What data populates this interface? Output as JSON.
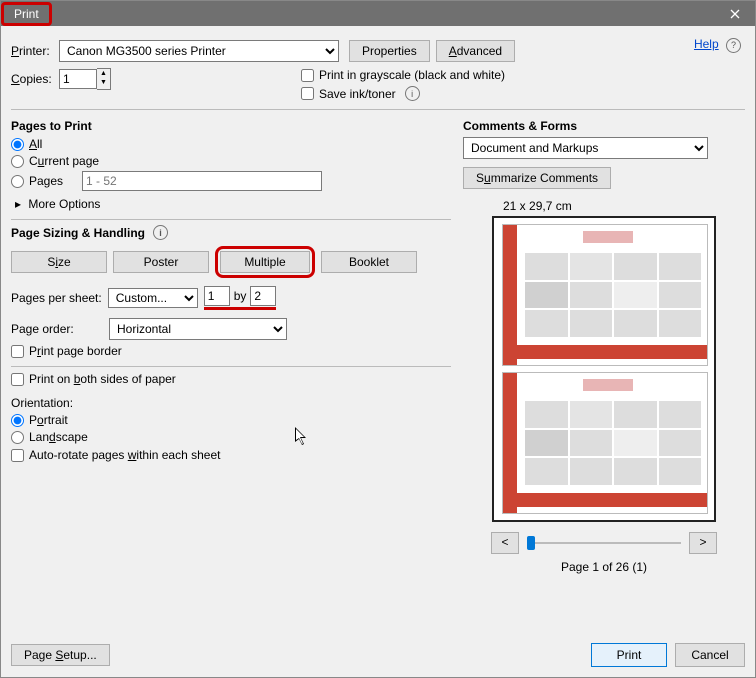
{
  "window": {
    "title": "Print"
  },
  "top": {
    "printer_label": "Printer:",
    "printer_value": "Canon MG3500 series Printer",
    "properties": "Properties",
    "advanced": "Advanced",
    "help": "Help",
    "copies_label": "Copies:",
    "copies_value": "1",
    "grayscale": "Print in grayscale (black and white)",
    "save_ink": "Save ink/toner"
  },
  "pages": {
    "title": "Pages to Print",
    "all": "All",
    "current": "Current page",
    "pages": "Pages",
    "pages_placeholder": "1 - 52",
    "more": "More Options"
  },
  "sizing": {
    "title": "Page Sizing & Handling",
    "size": "Size",
    "poster": "Poster",
    "multiple": "Multiple",
    "booklet": "Booklet",
    "pps_label": "Pages per sheet:",
    "pps_value": "Custom...",
    "pps_x": "1",
    "by": "by",
    "pps_y": "2",
    "order_label": "Page order:",
    "order_value": "Horizontal",
    "border": "Print page border",
    "both_sides": "Print on both sides of paper",
    "orientation": "Orientation:",
    "portrait": "Portrait",
    "landscape": "Landscape",
    "auto_rotate": "Auto-rotate pages within each sheet"
  },
  "comments": {
    "title": "Comments & Forms",
    "value": "Document and Markups",
    "summarize": "Summarize Comments"
  },
  "preview": {
    "dims": "21 x 29,7 cm",
    "prev": "<",
    "next": ">",
    "page_of": "Page 1 of 26 (1)"
  },
  "footer": {
    "page_setup": "Page Setup...",
    "print": "Print",
    "cancel": "Cancel"
  }
}
